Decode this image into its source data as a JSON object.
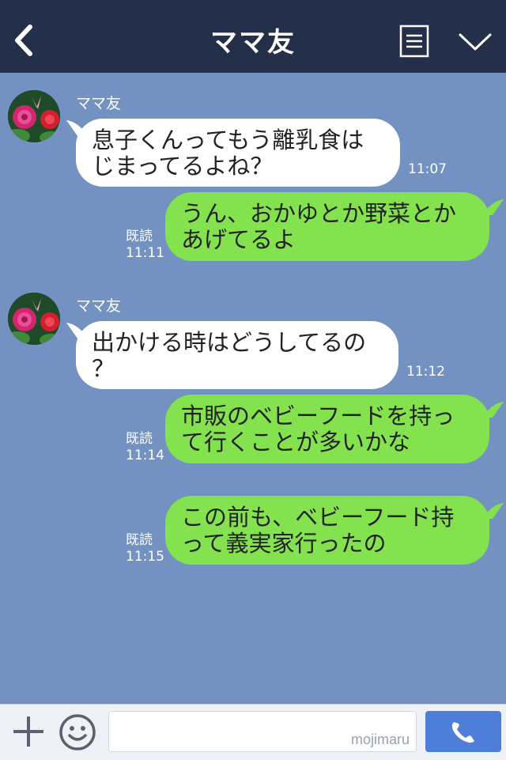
{
  "header": {
    "title": "ママ友"
  },
  "messages": [
    {
      "sender": "ママ友",
      "line1": "息子くんってもう離乳食は",
      "line2": "じまってるよね？",
      "time": "11:07"
    },
    {
      "line1": "うん、おかゆとか野菜とか",
      "line2": "あげてるよ",
      "read": "既読",
      "time": "11:11"
    },
    {
      "sender": "ママ友",
      "line1": "出かける時はどうしてるの",
      "line2": "？",
      "time": "11:12"
    },
    {
      "line1": "市販のベビーフードを持っ",
      "line2": "て行くことが多いかな",
      "read": "既読",
      "time": "11:14"
    },
    {
      "line1": "この前も、ベビーフード持",
      "line2": "って義実家行ったの",
      "read": "既読",
      "time": "11:15"
    }
  ],
  "footer": {
    "watermark": "mojimaru"
  },
  "colors": {
    "header": "#243049",
    "background": "#7392c1",
    "incoming": "#ffffff",
    "outgoing": "#83e24d",
    "call": "#4d7fd9"
  },
  "icons": [
    "chevron-left-icon",
    "menu-list-icon",
    "chevron-down-icon",
    "plus-icon",
    "smiley-icon",
    "phone-icon"
  ]
}
